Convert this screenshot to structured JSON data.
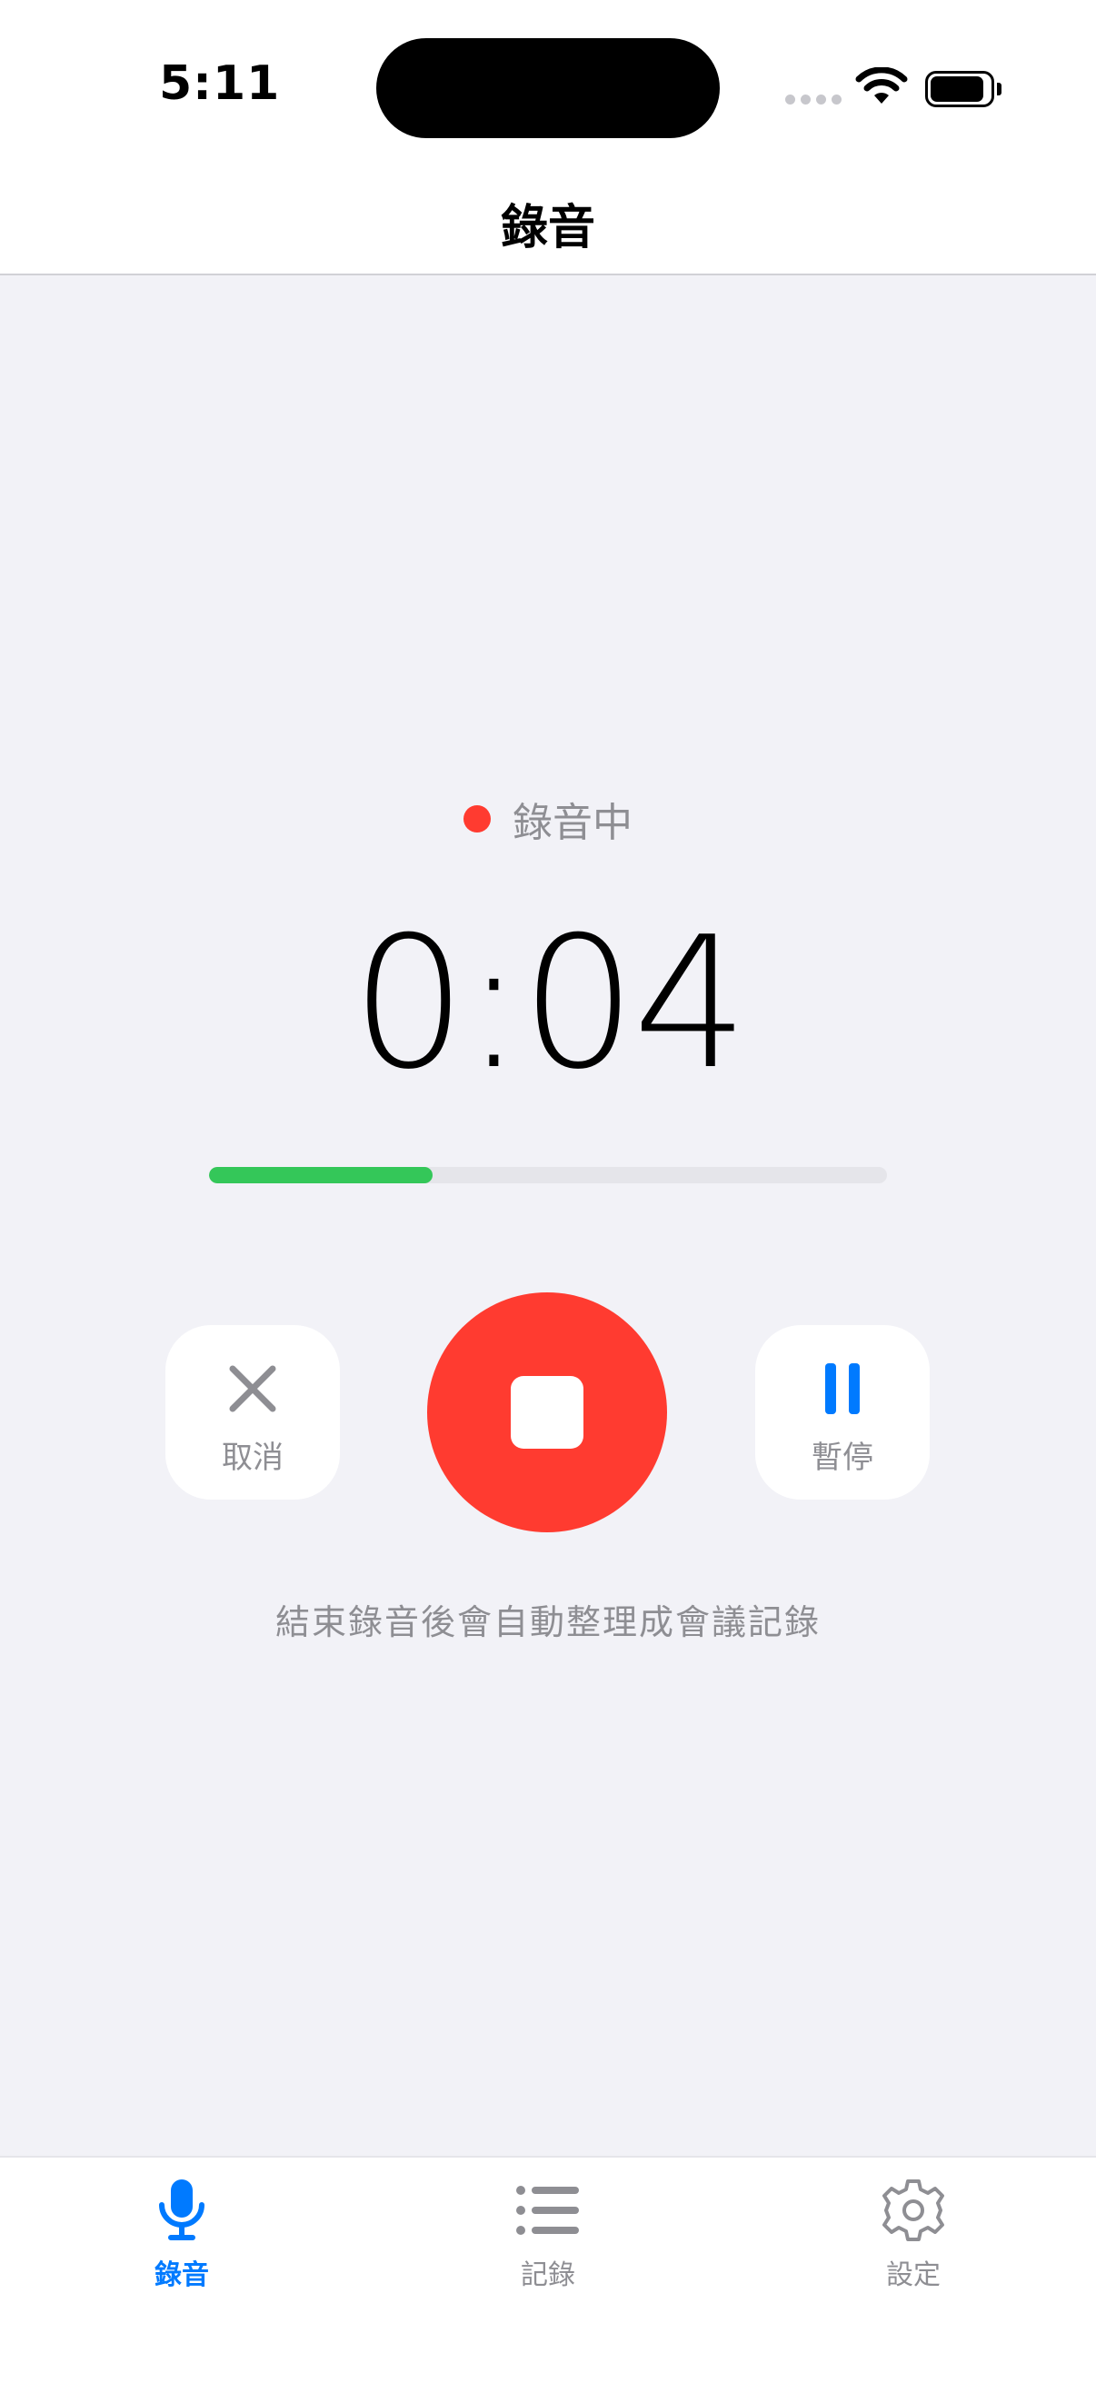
{
  "status_bar": {
    "time": "5:11",
    "icons": [
      "cellular-signal-icon",
      "wifi-icon",
      "battery-icon"
    ]
  },
  "nav": {
    "title": "錄音"
  },
  "recording": {
    "status_label": "錄音中",
    "timer": "0:04",
    "progress_fraction": 0.33,
    "colors": {
      "recording_dot": "#ff3b30",
      "progress": "#34c759",
      "accent": "#007aff"
    }
  },
  "controls": {
    "cancel_label": "取消",
    "pause_label": "暫停",
    "stop_icon": "stop-icon",
    "cancel_icon": "close-icon",
    "pause_icon": "pause-icon"
  },
  "hint": "結束錄音後會自動整理成會議記錄",
  "tabbar": {
    "items": [
      {
        "label": "錄音",
        "icon": "microphone-icon",
        "selected": true
      },
      {
        "label": "記錄",
        "icon": "list-icon",
        "selected": false
      },
      {
        "label": "設定",
        "icon": "gear-icon",
        "selected": false
      }
    ]
  }
}
